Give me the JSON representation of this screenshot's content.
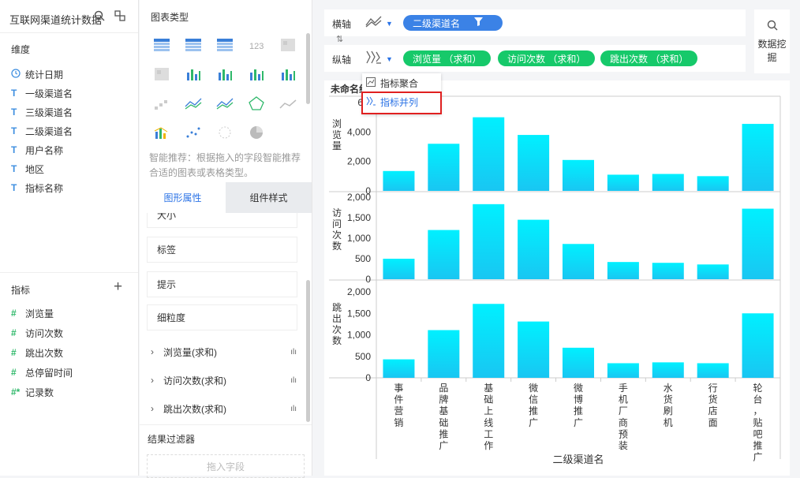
{
  "left": {
    "title": "互联网渠道统计数据",
    "dimension_header": "维度",
    "dimensions": [
      {
        "icon": "clock-icon",
        "label": "统计日期"
      },
      {
        "icon": "T",
        "label": "一级渠道名"
      },
      {
        "icon": "T",
        "label": "三级渠道名"
      },
      {
        "icon": "T",
        "label": "二级渠道名"
      },
      {
        "icon": "T",
        "label": "用户名称"
      },
      {
        "icon": "T",
        "label": "地区"
      },
      {
        "icon": "T",
        "label": "指标名称"
      }
    ],
    "measure_header": "指标",
    "add_symbol": "+",
    "measures": [
      {
        "icon": "#",
        "label": "浏览量"
      },
      {
        "icon": "#",
        "label": "访问次数"
      },
      {
        "icon": "#",
        "label": "跳出次数"
      },
      {
        "icon": "#",
        "label": "总停留时间"
      },
      {
        "icon": "#*",
        "label": "记录数"
      }
    ]
  },
  "mid": {
    "title": "图表类型",
    "hint": "智能推荐：根据拖入的字段智能推荐合适的图表或表格类型。",
    "tab_active": "图形属性",
    "tab_inactive": "组件样式",
    "props": [
      "大小",
      "标签",
      "提示",
      "细粒度"
    ],
    "measure_rows": [
      "浏览量(求和)",
      "访问次数(求和)",
      "跳出次数(求和)"
    ],
    "result_filter": "结果过滤器",
    "drop_placeholder": "拖入字段"
  },
  "axes": {
    "x_label": "横轴",
    "x_field": "二级渠道名",
    "y_label": "纵轴",
    "y_fields": [
      "浏览量 （求和）",
      "访问次数 （求和）",
      "跳出次数 （求和）"
    ]
  },
  "mining": "数据挖掘",
  "popup": {
    "item1": "指标聚合",
    "item2": "指标并列"
  },
  "chart_data": {
    "type": "bar",
    "title": "未命名组件",
    "xlabel": "二级渠道名",
    "categories": [
      "事件营销",
      "品牌基础推广",
      "基础上线工作",
      "微信推广",
      "微博推广",
      "手机厂商预装",
      "水货刷机",
      "行货店面",
      "轮台，贴吧推广"
    ],
    "category_labels": [
      [
        "事",
        "件",
        "营",
        "销"
      ],
      [
        "品",
        "牌",
        "基",
        "础",
        "推",
        "广"
      ],
      [
        "基",
        "础",
        "上",
        "线",
        "工",
        "作"
      ],
      [
        "微",
        "信",
        "推",
        "广"
      ],
      [
        "微",
        "博",
        "推",
        "广"
      ],
      [
        "手",
        "机",
        "厂",
        "商",
        "预",
        "装"
      ],
      [
        "水",
        "货",
        "刷",
        "机"
      ],
      [
        "行",
        "货",
        "店",
        "面"
      ],
      [
        "轮",
        "台",
        "，",
        "贴",
        "吧",
        "推",
        "广"
      ]
    ],
    "bar_color_top": "#00f0ff",
    "bar_color_bottom": "#19c6f2",
    "panels": [
      {
        "name": "浏览量",
        "ylabel_chars": [
          "浏",
          "览",
          "量"
        ],
        "ylim": [
          0,
          6000
        ],
        "ticks": [
          0,
          2000,
          4000,
          6000
        ],
        "tick_labels": [
          "0",
          "2,000",
          "4,000",
          "6,0"
        ],
        "values": [
          1350,
          3200,
          5000,
          3800,
          2100,
          1100,
          1150,
          1000,
          4550
        ]
      },
      {
        "name": "访问次数",
        "ylabel_chars": [
          "访",
          "问",
          "次",
          "数"
        ],
        "ylim": [
          0,
          2000
        ],
        "ticks": [
          0,
          500,
          1000,
          1500,
          2000
        ],
        "tick_labels": [
          "0",
          "500",
          "1,000",
          "1,500",
          "2,000"
        ],
        "values": [
          500,
          1200,
          1830,
          1450,
          860,
          420,
          400,
          360,
          1720
        ]
      },
      {
        "name": "跳出次数",
        "ylabel_chars": [
          "跳",
          "出",
          "次",
          "数"
        ],
        "ylim": [
          0,
          2000
        ],
        "ticks": [
          0,
          500,
          1000,
          1500,
          2000
        ],
        "tick_labels": [
          "0",
          "500",
          "1,000",
          "1,500",
          "2,000"
        ],
        "values": [
          430,
          1110,
          1720,
          1310,
          700,
          340,
          360,
          340,
          1500
        ]
      }
    ]
  }
}
